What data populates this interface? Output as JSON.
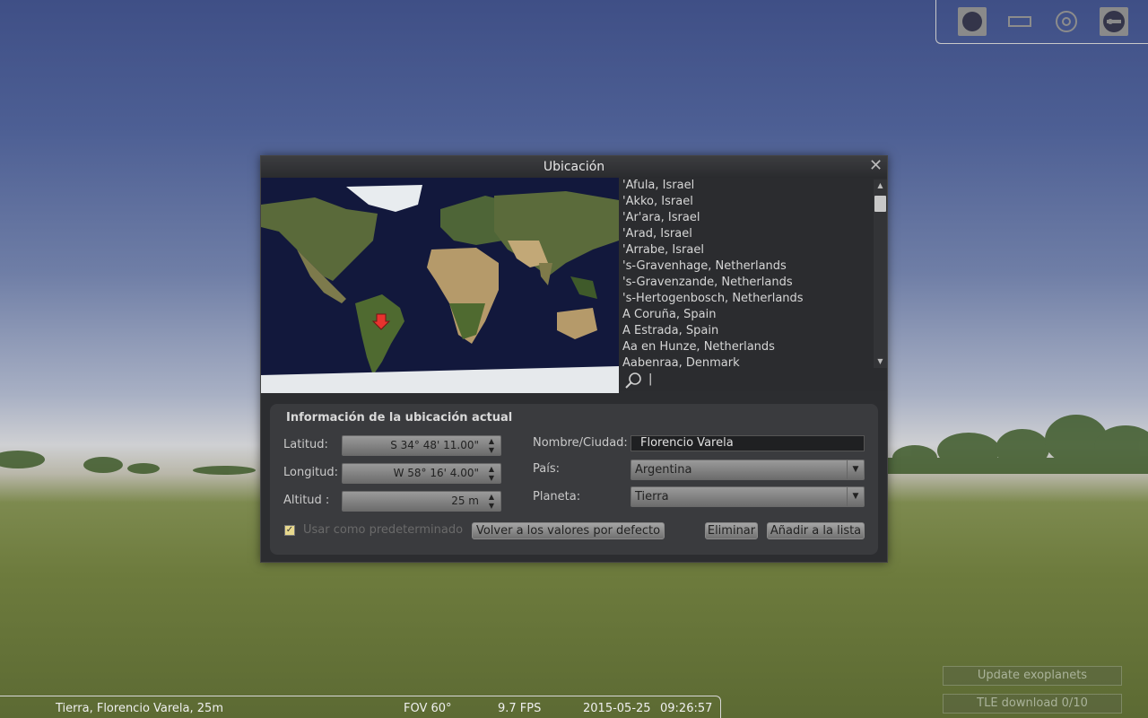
{
  "toolbar": {
    "icons": [
      "circle-view-icon",
      "rectangle-view-icon",
      "target-icon",
      "settings-icon"
    ]
  },
  "dialog": {
    "title": "Ubicación",
    "close_glyph": "✕",
    "location_list": [
      "'Afula, Israel",
      "'Akko, Israel",
      "'Ar'ara, Israel",
      "'Arad, Israel",
      "'Arrabe, Israel",
      "'s-Gravenhage, Netherlands",
      "'s-Gravenzande, Netherlands",
      "'s-Hertogenbosch, Netherlands",
      "A Coruña, Spain",
      "A Estrada, Spain",
      "Aa en Hunze, Netherlands",
      "Aabenraa, Denmark"
    ],
    "search_value": "|"
  },
  "info": {
    "section_title": "Información de la ubicación actual",
    "latitude_label": "Latitud:",
    "latitude_value": "S 34° 48' 11.00\"",
    "longitude_label": "Longitud:",
    "longitude_value": "W 58° 16' 4.00\"",
    "altitude_label": "Altitud :",
    "altitude_value": "25 m",
    "name_label": "Nombre/Ciudad:",
    "name_value": "Florencio Varela",
    "country_label": "País:",
    "country_value": "Argentina",
    "planet_label": "Planeta:",
    "planet_value": "Tierra",
    "default_checkbox_label": "Usar como predeterminado",
    "default_checked": true,
    "reset_button": "Volver a los valores por defecto",
    "delete_button": "Eliminar",
    "add_button": "Añadir a la lista"
  },
  "status": {
    "location": "Tierra, Florencio Varela, 25m",
    "fov": "FOV 60°",
    "fps": "9.7 FPS",
    "date": "2015-05-25",
    "time": "09:26:57"
  },
  "side_buttons": {
    "update_exoplanets": "Update exoplanets",
    "tle_download": "TLE download 0/10"
  }
}
